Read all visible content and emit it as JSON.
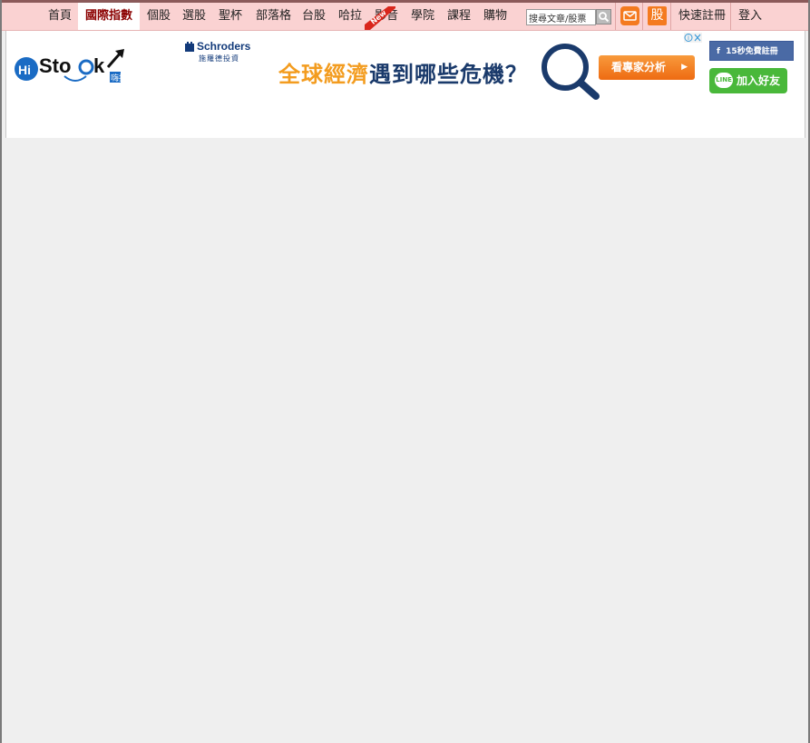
{
  "nav": {
    "items": [
      {
        "label": "首頁"
      },
      {
        "label": "國際指數"
      },
      {
        "label": "個股"
      },
      {
        "label": "選股"
      },
      {
        "label": "聖杯"
      },
      {
        "label": "部落格"
      },
      {
        "label": "台股"
      },
      {
        "label": "哈拉"
      },
      {
        "label": "影音"
      },
      {
        "label": "學院"
      },
      {
        "label": "課程"
      },
      {
        "label": "購物"
      }
    ],
    "new_badge": "New",
    "search_placeholder": "搜尋文章/股票",
    "stock_button": "股",
    "register": "快速註冊",
    "login": "登入"
  },
  "logo": {
    "text": "HiStock",
    "sub": "嗨投資"
  },
  "ad": {
    "brand": "Schroders",
    "brand_sub": "施羅德投資",
    "headline_part1": "全球經濟",
    "headline_part2": "遇到哪些危機？",
    "cta": "看專家分析"
  },
  "social": {
    "facebook": "15秒免費註冊",
    "line": "加入好友",
    "line_icon": "LINE"
  },
  "colors": {
    "nav_bg": "#fad2d2",
    "accent": "#f47a1f",
    "active_text": "#8b0000"
  }
}
